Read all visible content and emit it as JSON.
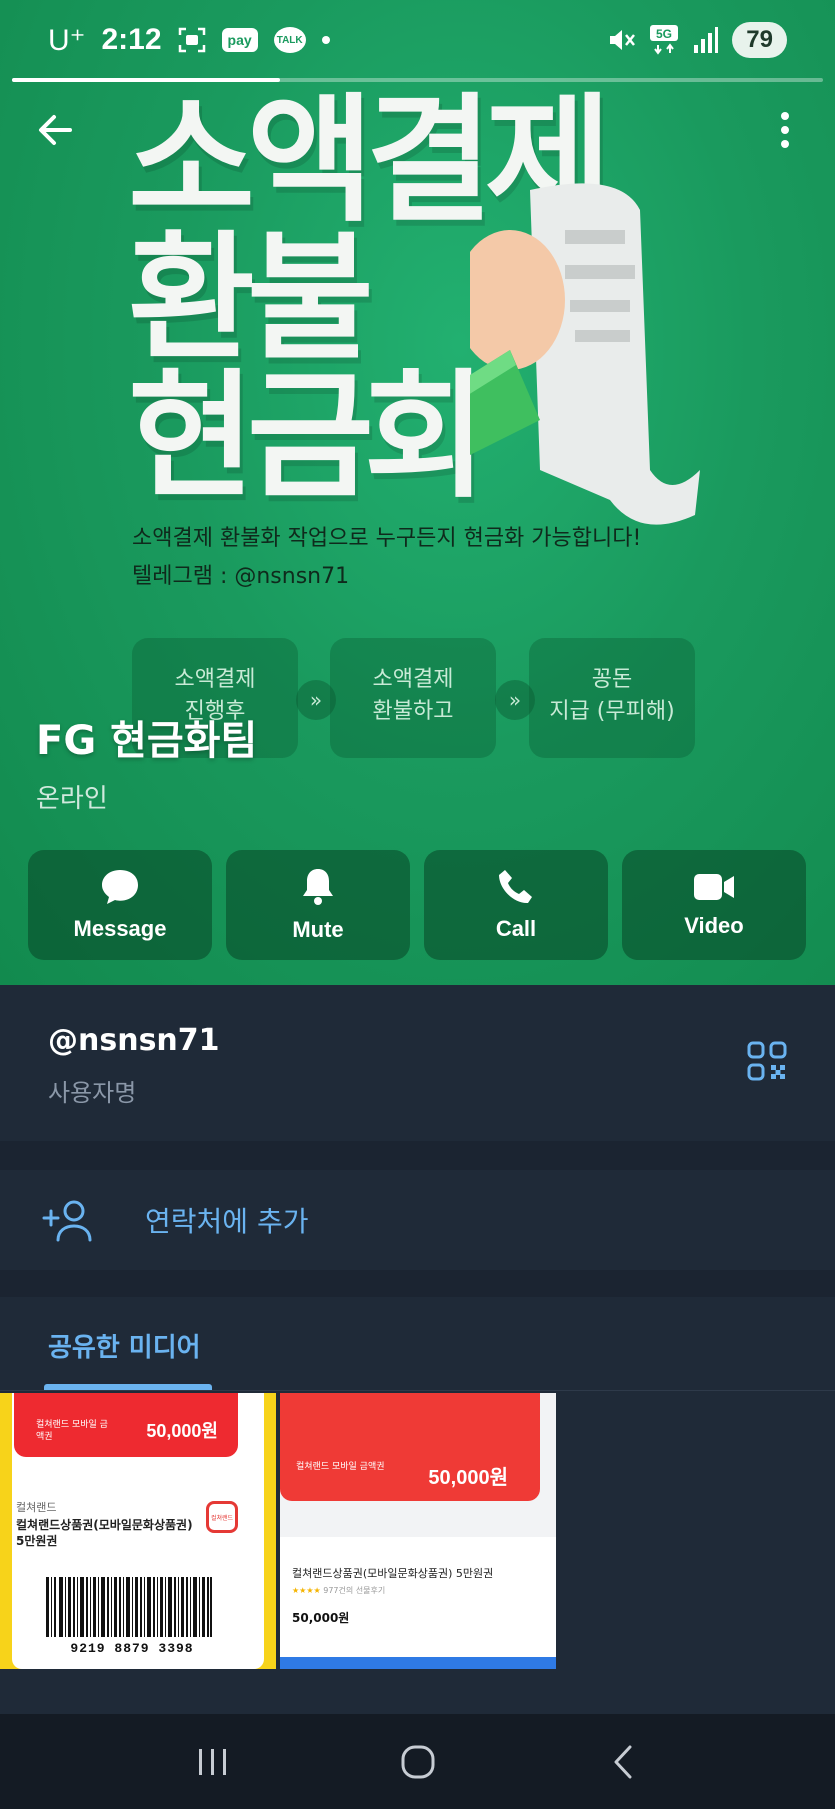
{
  "status_bar": {
    "carrier": "U⁺",
    "time": "2:12",
    "pay_badge": "pay",
    "talk_badge": "TALK",
    "network": "5G",
    "battery": "79"
  },
  "story_progress": 0.33,
  "poster": {
    "headline_1": "소액결제",
    "headline_2": "환불",
    "headline_3": "현금화",
    "line_1": "소액결제 환불화 작업으로 누구든지 현금화 가능합니다!",
    "line_2": "텔레그램 : @nsnsn71",
    "steps": [
      {
        "title": "소액결제",
        "sub": "진행후"
      },
      {
        "title": "소액결제",
        "sub": "환불하고"
      },
      {
        "title": "꽁돈",
        "sub": "지급 (무피해)"
      }
    ]
  },
  "profile": {
    "name": "FG 현금화팀",
    "status": "온라인"
  },
  "actions": [
    {
      "label": "Message",
      "icon": "message-icon"
    },
    {
      "label": "Mute",
      "icon": "bell-icon"
    },
    {
      "label": "Call",
      "icon": "phone-icon"
    },
    {
      "label": "Video",
      "icon": "video-icon"
    }
  ],
  "username": {
    "value": "@nsnsn71",
    "label": "사용자명"
  },
  "contact": {
    "add_label": "연락처에 추가"
  },
  "media": {
    "tab_label": "공유한 미디어",
    "thumb1": {
      "brand": "컬쳐랜드 모바일 금액권",
      "price": "50,000원",
      "small": "컬쳐랜드",
      "title": "컬쳐랜드상품권(모바일문화상품권) 5만원권",
      "logo": "컬쳐랜드",
      "barcode_number": "9219 8879 3398"
    },
    "thumb2": {
      "brand": "컬쳐랜드 모바일 금액권",
      "price": "50,000원",
      "title": "컬쳐랜드상품권(모바일문화상품권) 5만원권",
      "stars": "★★★★",
      "rating": "977건의 선물후기",
      "amount": "50,000원"
    }
  },
  "colors": {
    "hero_green": "#1a9a5e",
    "accent_blue": "#6ab3f0",
    "panel_bg": "#1f2a38",
    "page_bg": "#1b2431"
  }
}
